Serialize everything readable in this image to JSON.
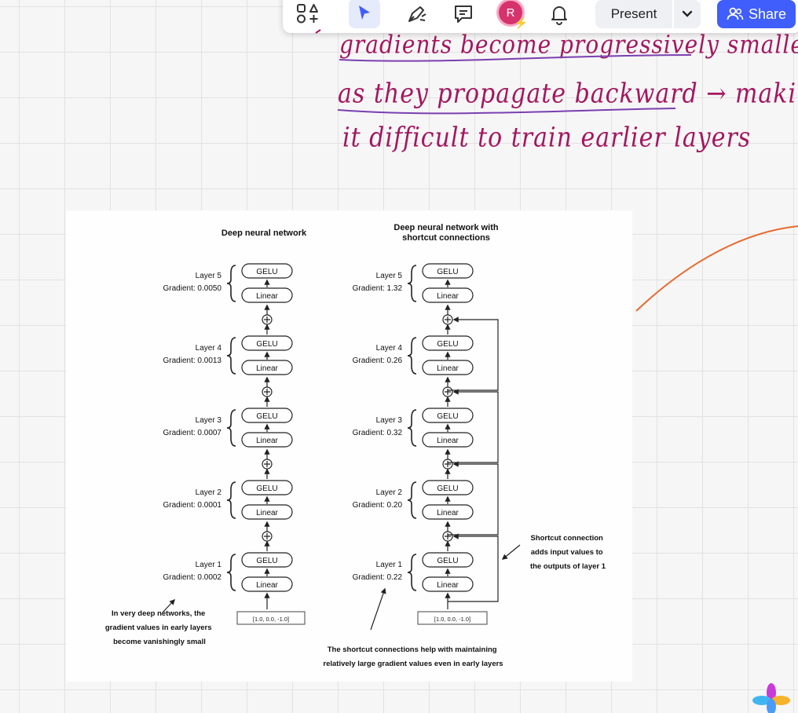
{
  "toolbar": {
    "present_label": "Present",
    "share_label": "Share",
    "avatar_initial": "R",
    "icons": [
      "shapes-icon",
      "select-cursor-icon",
      "pen-icon",
      "note-icon",
      "bell-icon",
      "chevron-down-icon",
      "people-icon"
    ],
    "colors": {
      "share_bg": "#3f5efb",
      "avatar_bg": "#d6336c",
      "select_bg": "#e6ebfb"
    }
  },
  "notes": {
    "line1": "gradients become progressively smaller",
    "line2": "as they propagate backward → making",
    "line3": "it difficult to train earlier layers",
    "colors": {
      "ink": "#a3175f",
      "underline": "#7b3fb0",
      "curve": "#e8692d"
    }
  },
  "diagram": {
    "left_title": "Deep neural network",
    "right_title_1": "Deep neural network with",
    "right_title_2": "shortcut connections",
    "gelu_label": "GELU",
    "linear_label": "Linear",
    "left_layers": [
      {
        "name": "Layer 5",
        "gradient": "Gradient: 0.0050"
      },
      {
        "name": "Layer 4",
        "gradient": "Gradient: 0.0013"
      },
      {
        "name": "Layer 3",
        "gradient": "Gradient: 0.0007"
      },
      {
        "name": "Layer 2",
        "gradient": "Gradient: 0.0001"
      },
      {
        "name": "Layer 1",
        "gradient": "Gradient: 0.0002"
      }
    ],
    "right_layers": [
      {
        "name": "Layer 5",
        "gradient": "Gradient: 1.32"
      },
      {
        "name": "Layer 4",
        "gradient": "Gradient: 0.26"
      },
      {
        "name": "Layer 3",
        "gradient": "Gradient: 0.32"
      },
      {
        "name": "Layer 2",
        "gradient": "Gradient: 0.20"
      },
      {
        "name": "Layer 1",
        "gradient": "Gradient: 0.22"
      }
    ],
    "input_vector": "[1.0,  0.0,  -1.0]",
    "left_note": [
      "In very deep networks, the",
      "gradient values in early layers",
      "become vanishingly small"
    ],
    "shortcut_note": [
      "Shortcut connection",
      "adds input values to",
      "the outputs of layer 1"
    ],
    "bottom_note": [
      "The shortcut connections help with maintaining",
      "relatively large gradient values even in early layers"
    ]
  }
}
